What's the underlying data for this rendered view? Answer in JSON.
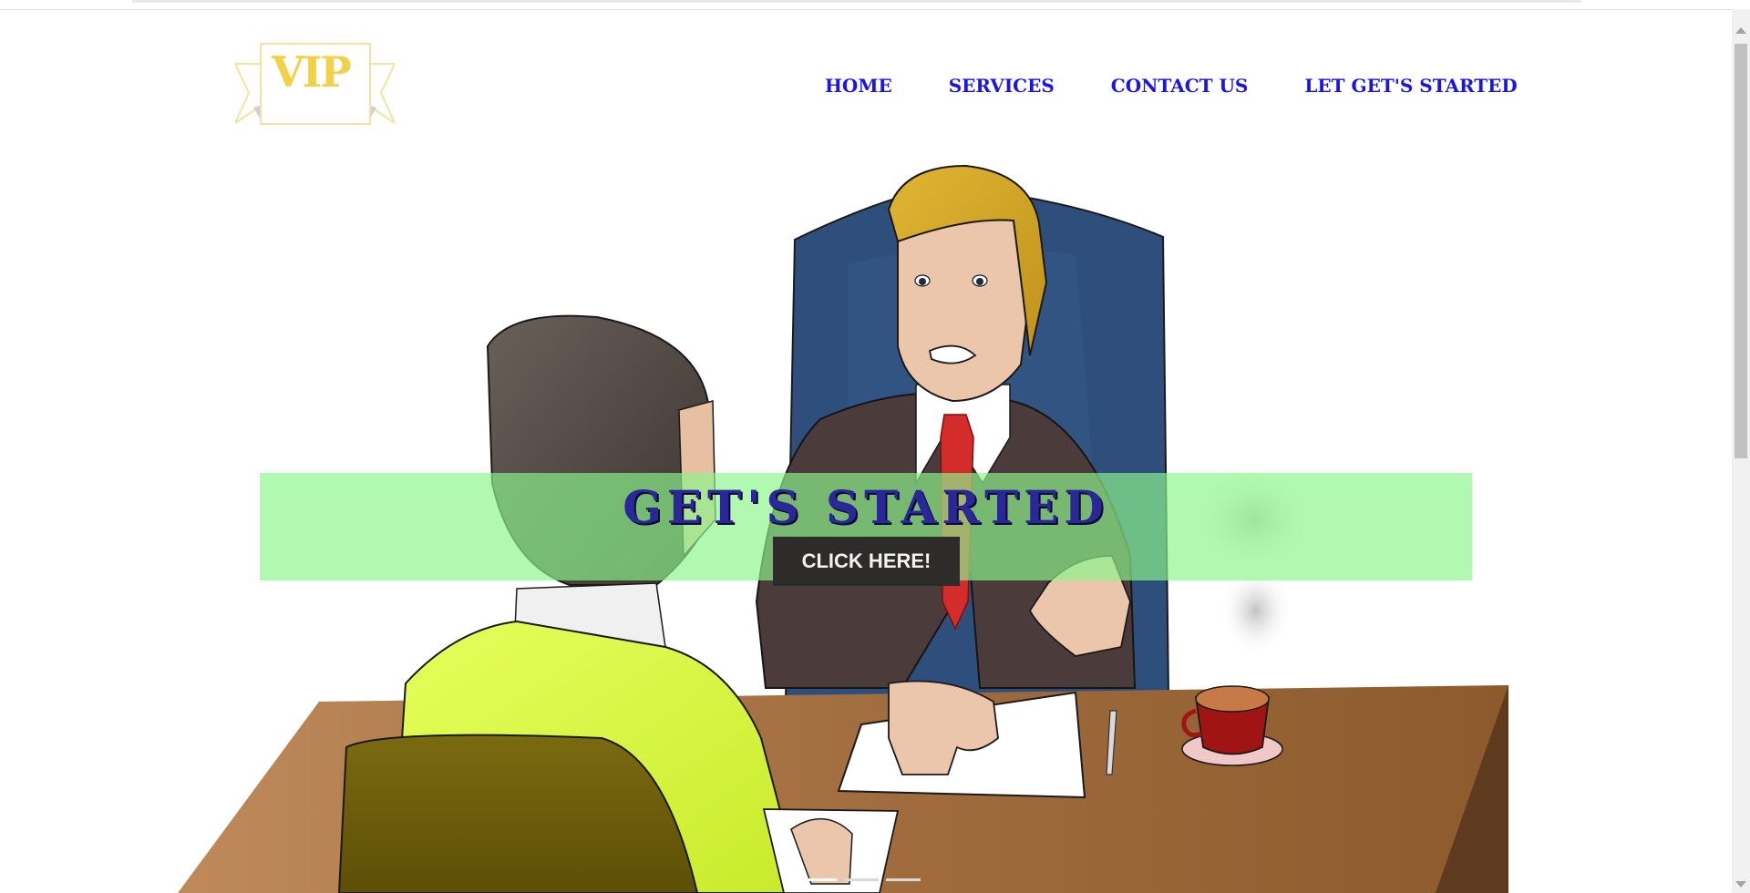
{
  "header": {
    "logo_text": "VIP",
    "nav": [
      {
        "label": "HOME"
      },
      {
        "label": "SERVICES"
      },
      {
        "label": "CONTACT US"
      },
      {
        "label": "LET GET'S STARTED"
      }
    ]
  },
  "hero": {
    "title": "GET'S STARTED",
    "button_label": "CLICK HERE!",
    "carousel": {
      "slide_count": 3,
      "active_index": 0
    }
  },
  "colors": {
    "nav_link": "#1a14e6",
    "logo": "#f1d04a",
    "banner_bg": "#8cf58c",
    "banner_title": "#2a2896",
    "button_bg": "#2e2b2b"
  },
  "icons": [
    "vip-ribbon-logo",
    "interview-illustration",
    "scroll-up-arrow",
    "scroll-down-arrow"
  ]
}
